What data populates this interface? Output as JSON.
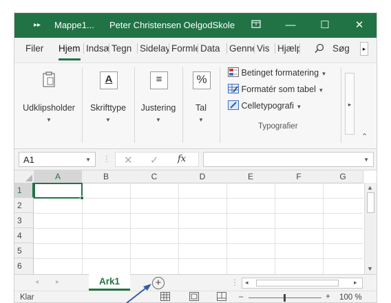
{
  "titlebar": {
    "filename": "Mappe1...",
    "user": "Peter Christensen OelgodSkole",
    "icons": [
      "quick-access-icon",
      "ribbon-display-icon",
      "minimize-icon",
      "maximize-icon",
      "close-icon"
    ]
  },
  "tabs": [
    {
      "label": "Filer"
    },
    {
      "label": "Hjem",
      "active": true
    },
    {
      "label": "Indsæt"
    },
    {
      "label": "Tegn"
    },
    {
      "label": "Sidelayout"
    },
    {
      "label": "Formler"
    },
    {
      "label": "Data"
    },
    {
      "label": "Gennemse"
    },
    {
      "label": "Vis"
    },
    {
      "label": "Hjælp"
    }
  ],
  "search_label": "Søg",
  "ribbon": {
    "clipboard": "Udklipsholder",
    "font": "Skrifttype",
    "alignment": "Justering",
    "number": "Tal",
    "styles_group": "Typografier",
    "styles_items": [
      {
        "label": "Betinget formatering",
        "icon": "conditional-formatting-icon"
      },
      {
        "label": "Formatér som tabel",
        "icon": "format-table-icon"
      },
      {
        "label": "Celletypografi",
        "icon": "cell-styles-icon"
      }
    ]
  },
  "formula_bar": {
    "name_box": "A1",
    "fx": "fx",
    "formula": ""
  },
  "grid": {
    "columns": [
      "A",
      "B",
      "C",
      "D",
      "E",
      "F",
      "G"
    ],
    "rows": [
      "1",
      "2",
      "3",
      "4",
      "5",
      "6"
    ],
    "selected_cell": "A1"
  },
  "sheets": [
    {
      "name": "Ark1",
      "active": true
    }
  ],
  "status": {
    "ready": "Klar",
    "zoom": "100 %"
  },
  "colors": {
    "accent": "#217346",
    "arrow": "#2f5ea8"
  }
}
